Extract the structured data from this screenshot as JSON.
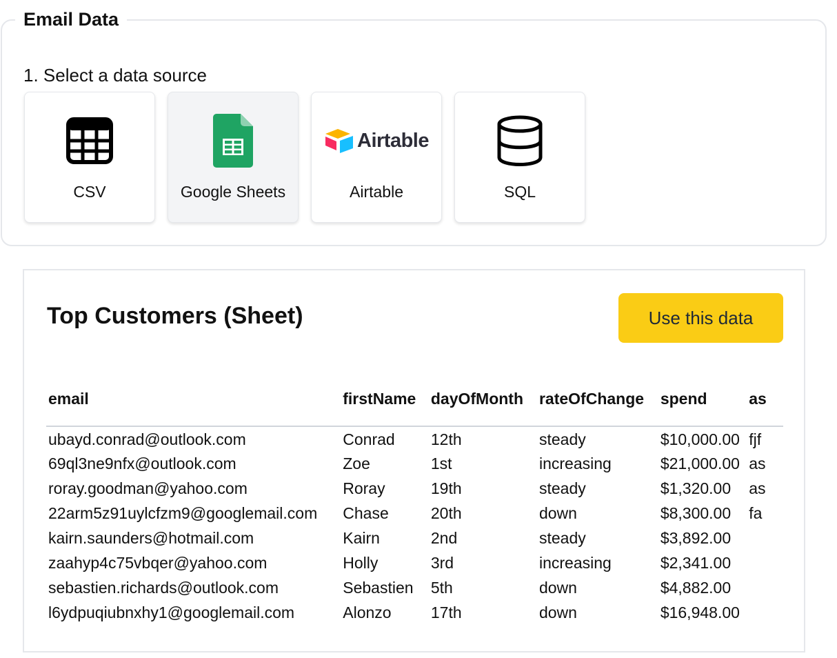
{
  "section": {
    "legend": "Email Data",
    "step_label": "1. Select a data source",
    "sources": [
      {
        "label": "CSV",
        "icon": "table-grid-icon"
      },
      {
        "label": "Google Sheets",
        "icon": "google-sheets-icon",
        "selected": true
      },
      {
        "label": "Airtable",
        "icon": "airtable-logo",
        "logo_text": "Airtable"
      },
      {
        "label": "SQL",
        "icon": "database-icon"
      }
    ]
  },
  "preview": {
    "title": "Top Customers (Sheet)",
    "use_button_label": "Use this data",
    "button_color": "#facc15",
    "columns": [
      "email",
      "firstName",
      "dayOfMonth",
      "rateOfChange",
      "spend",
      "as"
    ],
    "rows": [
      [
        "ubayd.conrad@outlook.com",
        "Conrad",
        "12th",
        "steady",
        "$10,000.00",
        "fjf"
      ],
      [
        "69ql3ne9nfx@outlook.com",
        "Zoe",
        "1st",
        "increasing",
        "$21,000.00",
        "as"
      ],
      [
        "roray.goodman@yahoo.com",
        "Roray",
        "19th",
        "steady",
        "$1,320.00",
        "as"
      ],
      [
        "22arm5z91uylcfzm9@googlemail.com",
        "Chase",
        "20th",
        "down",
        "$8,300.00",
        "fa"
      ],
      [
        "kairn.saunders@hotmail.com",
        "Kairn",
        "2nd",
        "steady",
        "$3,892.00",
        ""
      ],
      [
        "zaahyp4c75vbqer@yahoo.com",
        "Holly",
        "3rd",
        "increasing",
        "$2,341.00",
        ""
      ],
      [
        "sebastien.richards@outlook.com",
        "Sebastien",
        "5th",
        "down",
        "$4,882.00",
        ""
      ],
      [
        "l6ydpuqiubnxhy1@googlemail.com",
        "Alonzo",
        "17th",
        "down",
        "$16,948.00",
        ""
      ]
    ]
  }
}
